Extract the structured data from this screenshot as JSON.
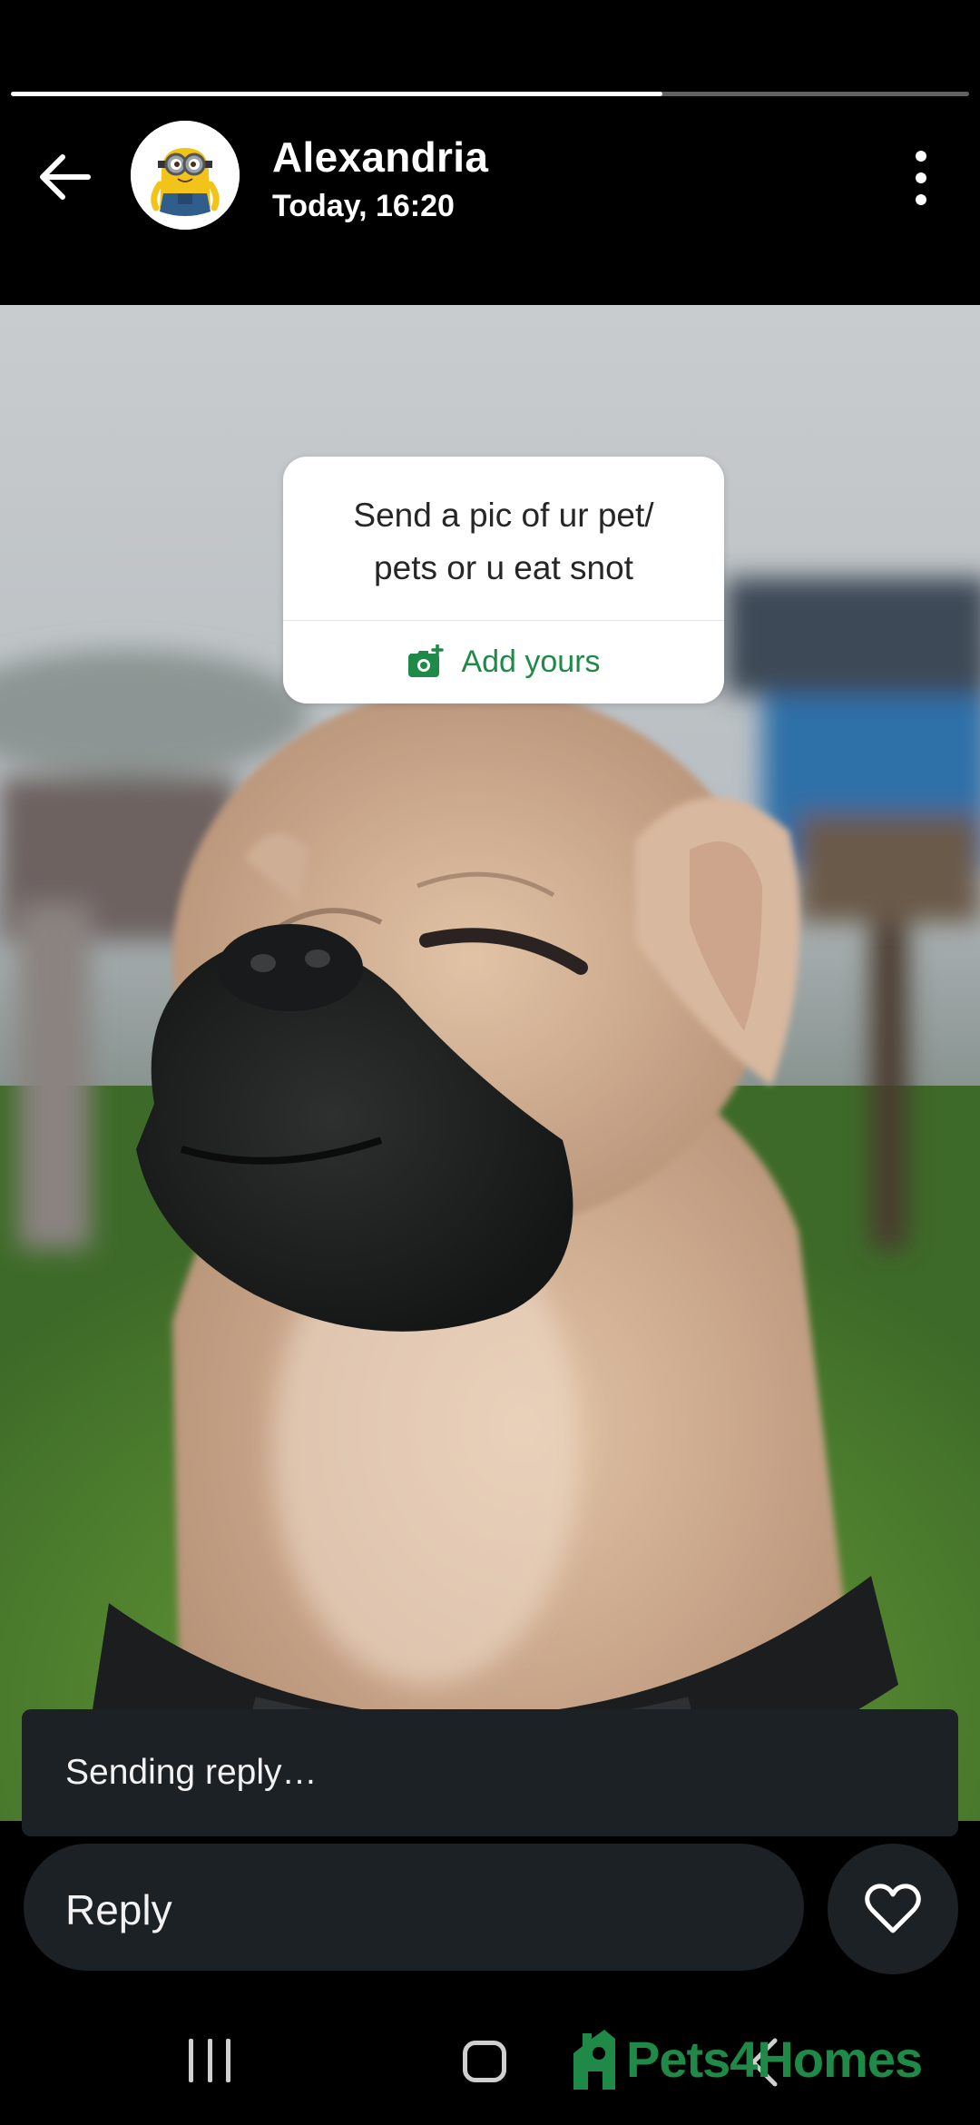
{
  "story": {
    "progress_fraction": 0.68
  },
  "header": {
    "username": "Alexandria",
    "timestamp": "Today, 16:20"
  },
  "sticker": {
    "text": "Send a pic of ur pet/\npets or u eat snot",
    "action_label": "Add yours"
  },
  "toast": {
    "text": "Sending reply…"
  },
  "reply": {
    "placeholder": "Reply"
  },
  "watermark": {
    "brand": "Pets4Homes"
  },
  "colors": {
    "accent_green": "#1f8a47",
    "bar_dark": "#1c2126"
  }
}
